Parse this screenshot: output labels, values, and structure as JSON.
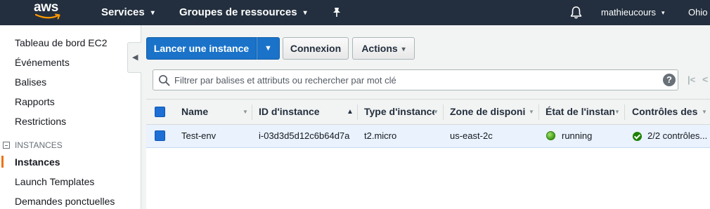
{
  "topnav": {
    "logo_text": "aws",
    "services_label": "Services",
    "resource_groups_label": "Groupes de ressources",
    "user_label": "mathieucours",
    "region_label": "Ohio",
    "caret": "▾",
    "icons": {
      "pin": "pin-icon",
      "bell": "bell-icon"
    }
  },
  "sidebar": {
    "items": [
      {
        "label": "Tableau de bord EC2"
      },
      {
        "label": "Événements"
      },
      {
        "label": "Balises"
      },
      {
        "label": "Rapports"
      },
      {
        "label": "Restrictions"
      }
    ],
    "section_label": "INSTANCES",
    "section_items": [
      {
        "label": "Instances",
        "active": true
      },
      {
        "label": "Launch Templates"
      },
      {
        "label": "Demandes ponctuelles"
      }
    ],
    "active_color": "#ec7211"
  },
  "toolbar": {
    "launch_label": "Lancer une instance",
    "connect_label": "Connexion",
    "actions_label": "Actions",
    "primary_color": "#1a73c9"
  },
  "search": {
    "placeholder": "Filtrer par balises et attributs ou rechercher par mot clé",
    "help": "?"
  },
  "table": {
    "columns": [
      {
        "label": "Name"
      },
      {
        "label": "ID d'instance"
      },
      {
        "label": "Type d'instance"
      },
      {
        "label": "Zone de disponibilité"
      },
      {
        "label": "État de l'instance"
      },
      {
        "label": "Contrôles des statuts"
      }
    ],
    "rows": [
      {
        "name": "Test-env",
        "instance_id": "i-03d3d5d12c6b64d7a",
        "instance_type": "t2.micro",
        "zone": "us-east-2c",
        "state": "running",
        "status_checks": "2/2 contrôles..."
      }
    ],
    "selected_row_color": "#e9f2fd",
    "status_color": "#1d8102"
  }
}
